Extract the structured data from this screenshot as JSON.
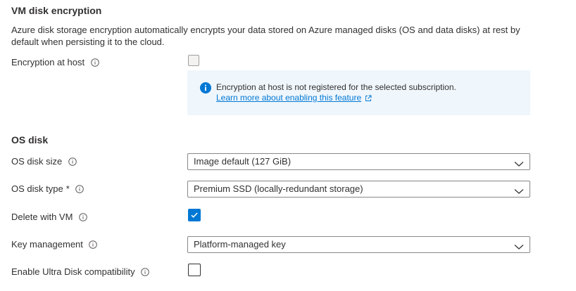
{
  "encryption": {
    "title": "VM disk encryption",
    "description": "Azure disk storage encryption automatically encrypts your data stored on Azure managed disks (OS and data disks) at rest by default when persisting it to the cloud.",
    "host_label": "Encryption at host",
    "host_checked": false,
    "host_disabled": true,
    "notice": {
      "text": "Encryption at host is not registered for the selected subscription.",
      "link_text": "Learn more about enabling this feature"
    }
  },
  "os_disk": {
    "title": "OS disk",
    "size": {
      "label": "OS disk size",
      "value": "Image default (127 GiB)"
    },
    "type": {
      "label": "OS disk type",
      "required_marker": "*",
      "value": "Premium SSD (locally-redundant storage)"
    },
    "delete_with_vm": {
      "label": "Delete with VM",
      "checked": true
    },
    "key_management": {
      "label": "Key management",
      "value": "Platform-managed key"
    },
    "ultra_disk": {
      "label": "Enable Ultra Disk compatibility",
      "checked": false
    }
  },
  "colors": {
    "accent": "#0078d4",
    "text": "#323130",
    "notice_bg": "#eff6fc",
    "border": "#8a8886"
  },
  "icons": {
    "info": "info-circle-icon",
    "notice": "info-filled-icon",
    "external": "external-link-icon",
    "chevron": "chevron-down-icon",
    "check": "checkmark-icon"
  }
}
